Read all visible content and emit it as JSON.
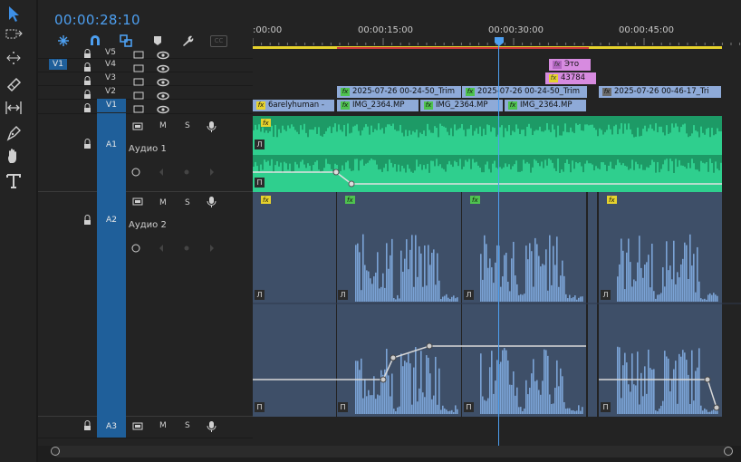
{
  "timecode": "00:00:28:10",
  "toolbar": {
    "tools": [
      "selection-tool",
      "track-select-tool",
      "ripple-edit-tool",
      "razor-tool",
      "slip-tool",
      "pen-tool",
      "hand-tool",
      "type-tool"
    ]
  },
  "header_icons": [
    "snap-icon",
    "magnet-icon",
    "linked-selection-icon",
    "marker-icon",
    "wrench-icon",
    "captions-icon"
  ],
  "header_captions_label": "CC",
  "ruler": {
    "labels": [
      ":00:00",
      "00:00:15:00",
      "00:00:30:00",
      "00:00:45:00"
    ]
  },
  "tracks": {
    "v1_source": "V1",
    "v5": "V5",
    "v4": "V4",
    "v3": "V3",
    "v2": "V2",
    "v1": "V1",
    "a1": "A1",
    "a1_name": "Аудио 1",
    "a2": "A2",
    "a2_name": "Аудио 2",
    "a3": "A3",
    "mute": "M",
    "solo": "S"
  },
  "video_clips": {
    "v4_clip": "Это",
    "v3_clip": "43784",
    "v2_clip1": "2025-07-26 00-24-50_Trim",
    "v2_clip2": "2025-07-26 00-24-50_Trim",
    "v2_clip3": "2025-07-26 00-46-17_Tri",
    "v1_clip1": "6arelyhuman -",
    "v1_clip2": "IMG_2364.MP",
    "v1_clip3": "IMG_2364.MP",
    "v1_clip4": "IMG_2364.MP"
  },
  "fx_label": "fx",
  "channel_letters": {
    "left": "Л",
    "right": "П"
  },
  "colors": {
    "accent_blue": "#4d9ff0",
    "audio1_green": "#2fcf8e",
    "audio2_blue": "#7ba3d6",
    "video_clip_blue": "#8eaad8",
    "pink_clip": "#d78be0",
    "target_blue": "#1f5f9a"
  }
}
